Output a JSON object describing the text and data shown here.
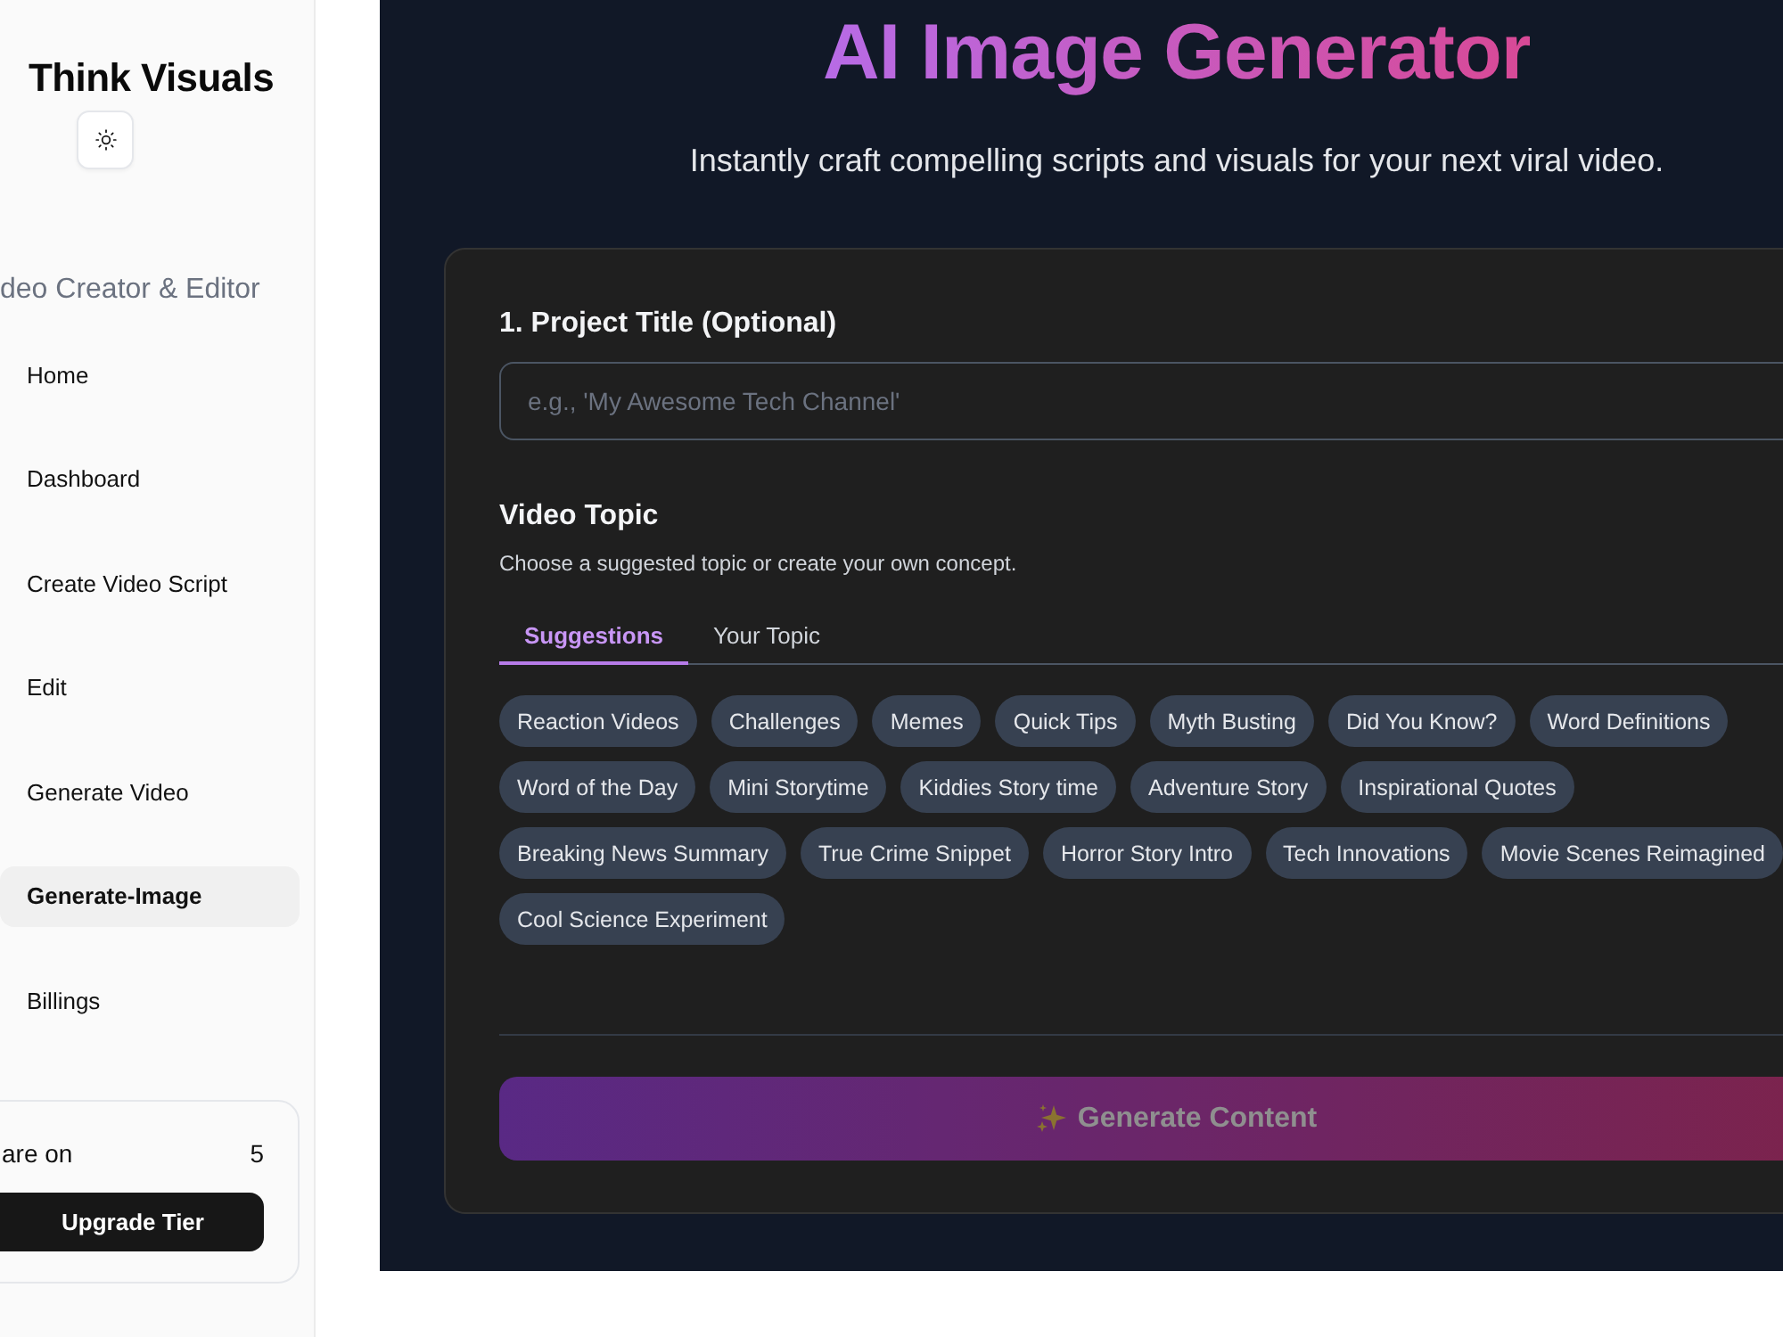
{
  "sidebar": {
    "title": "Think Visuals",
    "subtitle": "deo Creator & Editor",
    "nav": [
      {
        "label": "Home",
        "selected": false
      },
      {
        "label": "Dashboard",
        "selected": false
      },
      {
        "label": "Create Video Script",
        "selected": false
      },
      {
        "label": "Edit",
        "selected": false
      },
      {
        "label": "Generate Video",
        "selected": false
      },
      {
        "label": "Generate-Image",
        "selected": true
      },
      {
        "label": "Billings",
        "selected": false
      }
    ],
    "credits": {
      "label": "are on",
      "value": "5",
      "button": "Upgrade Tier"
    }
  },
  "main": {
    "title": "AI Image Generator",
    "subtitle": "Instantly craft compelling scripts and visuals for your next viral video.",
    "project_title": {
      "label": "1. Project Title (Optional)",
      "placeholder": "e.g., 'My Awesome Tech Channel'"
    },
    "video_topic": {
      "heading": "Video Topic",
      "description": "Choose a suggested topic or create your own concept.",
      "tabs": [
        {
          "label": "Suggestions",
          "selected": true
        },
        {
          "label": "Your Topic",
          "selected": false
        }
      ],
      "suggestions": [
        "Reaction Videos",
        "Challenges",
        "Memes",
        "Quick Tips",
        "Myth Busting",
        "Did You Know?",
        "Word Definitions",
        "Word of the Day",
        "Mini Storytime",
        "Kiddies Story time",
        "Adventure Story",
        "Inspirational Quotes",
        "Breaking News Summary",
        "True Crime Snippet",
        "Horror Story Intro",
        "Tech Innovations",
        "Movie Scenes Reimagined",
        "Cool Science Experiment"
      ]
    },
    "generate_button": {
      "label": "Generate Content",
      "disabled": true
    }
  }
}
